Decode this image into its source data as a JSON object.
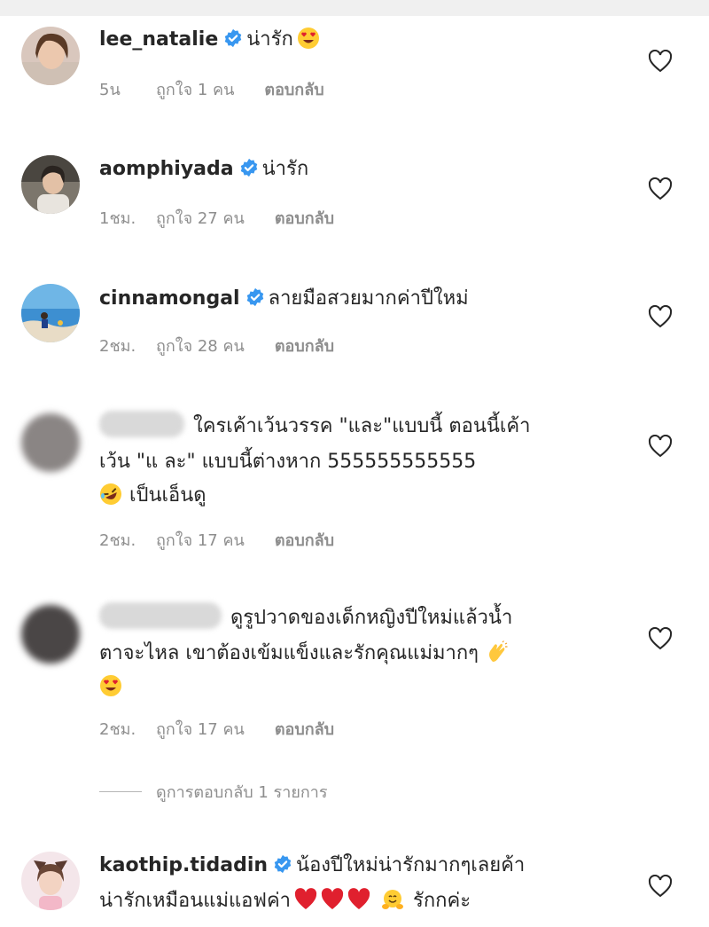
{
  "screen": {
    "title": ""
  },
  "comments": [
    {
      "username": "lee_natalie",
      "verified": true,
      "text": "น่ารัก",
      "emoji": [
        "heart-eyes"
      ],
      "time": "5น",
      "likes": "ถูกใจ 1 คน",
      "reply": "ตอบกลับ"
    },
    {
      "username": "aomphiyada",
      "verified": true,
      "text": "น่ารัก",
      "time": "1ชม.",
      "likes": "ถูกใจ 27 คน",
      "reply": "ตอบกลับ"
    },
    {
      "username": "cinnamongal",
      "verified": true,
      "text": "ลายมือสวยมากค่าปีใหม่",
      "time": "2ชม.",
      "likes": "ถูกใจ 28 คน",
      "reply": "ตอบกลับ"
    },
    {
      "username": "",
      "username_blurred": true,
      "text_line1": "ใครเค้าเว้นวรรค \"และ\"แบบนี้ ตอนนี้เค้า",
      "text_line2": "เว้น \"แ ละ\" แบบนี้ต่างหาก  555555555555",
      "text_line3": "เป็นเอ็นดู",
      "emoji": [
        "rofl"
      ],
      "time": "2ชม.",
      "likes": "ถูกใจ 17 คน",
      "reply": "ตอบกลับ"
    },
    {
      "username": "",
      "username_blurred": true,
      "text_line1": "ดูรูปวาดของเด็กหญิงปีใหม่แล้วน้ำ",
      "text_line2": "ตาจะไหล เขาต้องเข้มแข็งและรักคุณแม่มากๆ",
      "emoji": [
        "clapping-hands",
        "heart-eyes"
      ],
      "time": "2ชม.",
      "likes": "ถูกใจ 17 คน",
      "reply": "ตอบกลับ"
    },
    {
      "username": "kaothip.tidadin",
      "verified": true,
      "text_line1": "น้องปีใหม่น่ารักมากๆเลยค้า",
      "text_line2": "น่ารักเหมือนแม่แอฟค่า",
      "text_line2_end": "รักกค่ะ",
      "emoji": [
        "red-heart",
        "red-heart",
        "red-heart",
        "hugging-face"
      ]
    }
  ],
  "view_replies": "ดูการตอบกลับ 1 รายการ",
  "colors": {
    "verified": "#3897f0",
    "muted": "#8e8e8e",
    "text": "#262626",
    "heart_emoji": "#e0202e"
  }
}
